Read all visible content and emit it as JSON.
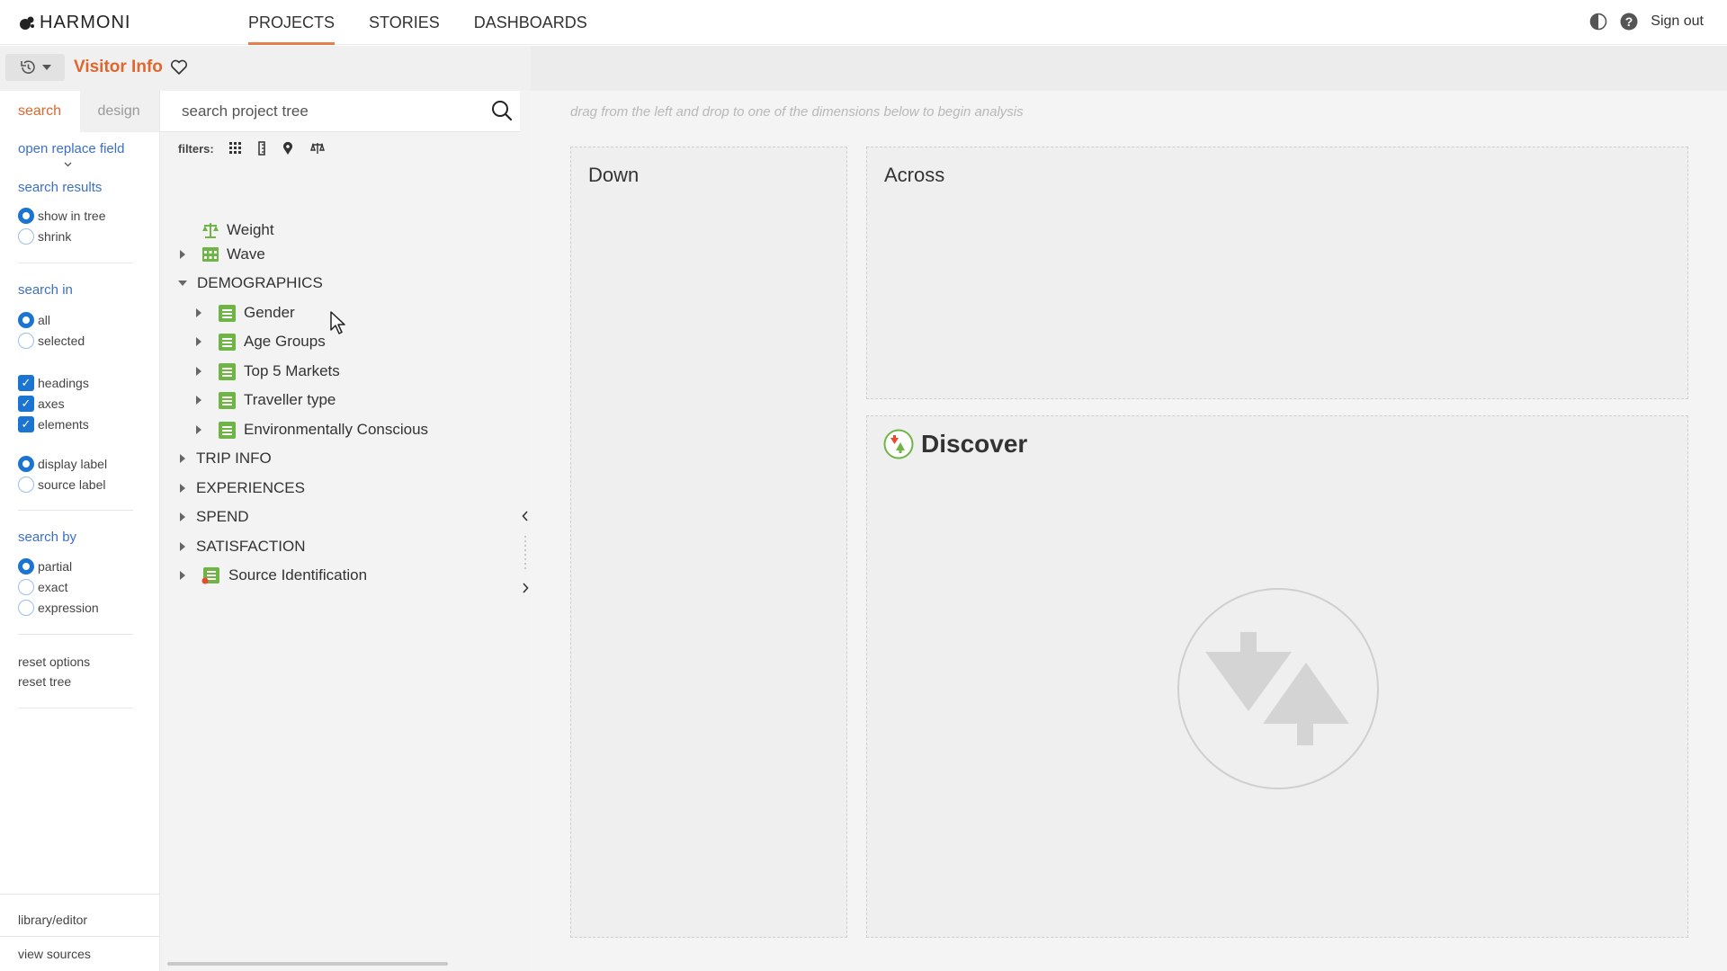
{
  "app": {
    "logo_text": "HARMONI",
    "nav": [
      {
        "label": "PROJECTS",
        "active": true
      },
      {
        "label": "STORIES",
        "active": false
      },
      {
        "label": "DASHBOARDS",
        "active": false
      }
    ],
    "sign_out": "Sign out",
    "accent_color": "#e0662d"
  },
  "project": {
    "title": "Visitor Info"
  },
  "options": {
    "tabs": {
      "search": "search",
      "design": "design"
    },
    "open_replace": "open replace field",
    "search_results": {
      "heading": "search results",
      "show_in_tree": "show in tree",
      "shrink": "shrink",
      "selected": "show in tree"
    },
    "search_in": {
      "heading": "search in",
      "all": "all",
      "selected_opt": "selected",
      "selected": "all"
    },
    "checks": {
      "headings": "headings",
      "axes": "axes",
      "elements": "elements"
    },
    "label_mode": {
      "display": "display label",
      "source": "source label",
      "selected": "display label"
    },
    "search_by": {
      "heading": "search by",
      "partial": "partial",
      "exact": "exact",
      "expression": "expression",
      "selected": "partial"
    },
    "reset_options": "reset options",
    "reset_tree": "reset tree",
    "library_editor": "library/editor",
    "view_sources": "view sources"
  },
  "tree": {
    "search_placeholder": "search project tree",
    "filters_label": "filters:",
    "items": {
      "weight": "Weight",
      "wave": "Wave",
      "demographics": "DEMOGRAPHICS",
      "gender": "Gender",
      "age_groups": "Age Groups",
      "top5": "Top 5 Markets",
      "traveller": "Traveller type",
      "env": "Environmentally Conscious",
      "trip": "TRIP INFO",
      "experiences": "EXPERIENCES",
      "spend": "SPEND",
      "satisfaction": "SATISFACTION",
      "source_id": "Source Identification"
    }
  },
  "analysis": {
    "hint": "drag from the left and drop to one of the dimensions below to begin analysis",
    "down": "Down",
    "across": "Across",
    "discover": "Discover"
  }
}
